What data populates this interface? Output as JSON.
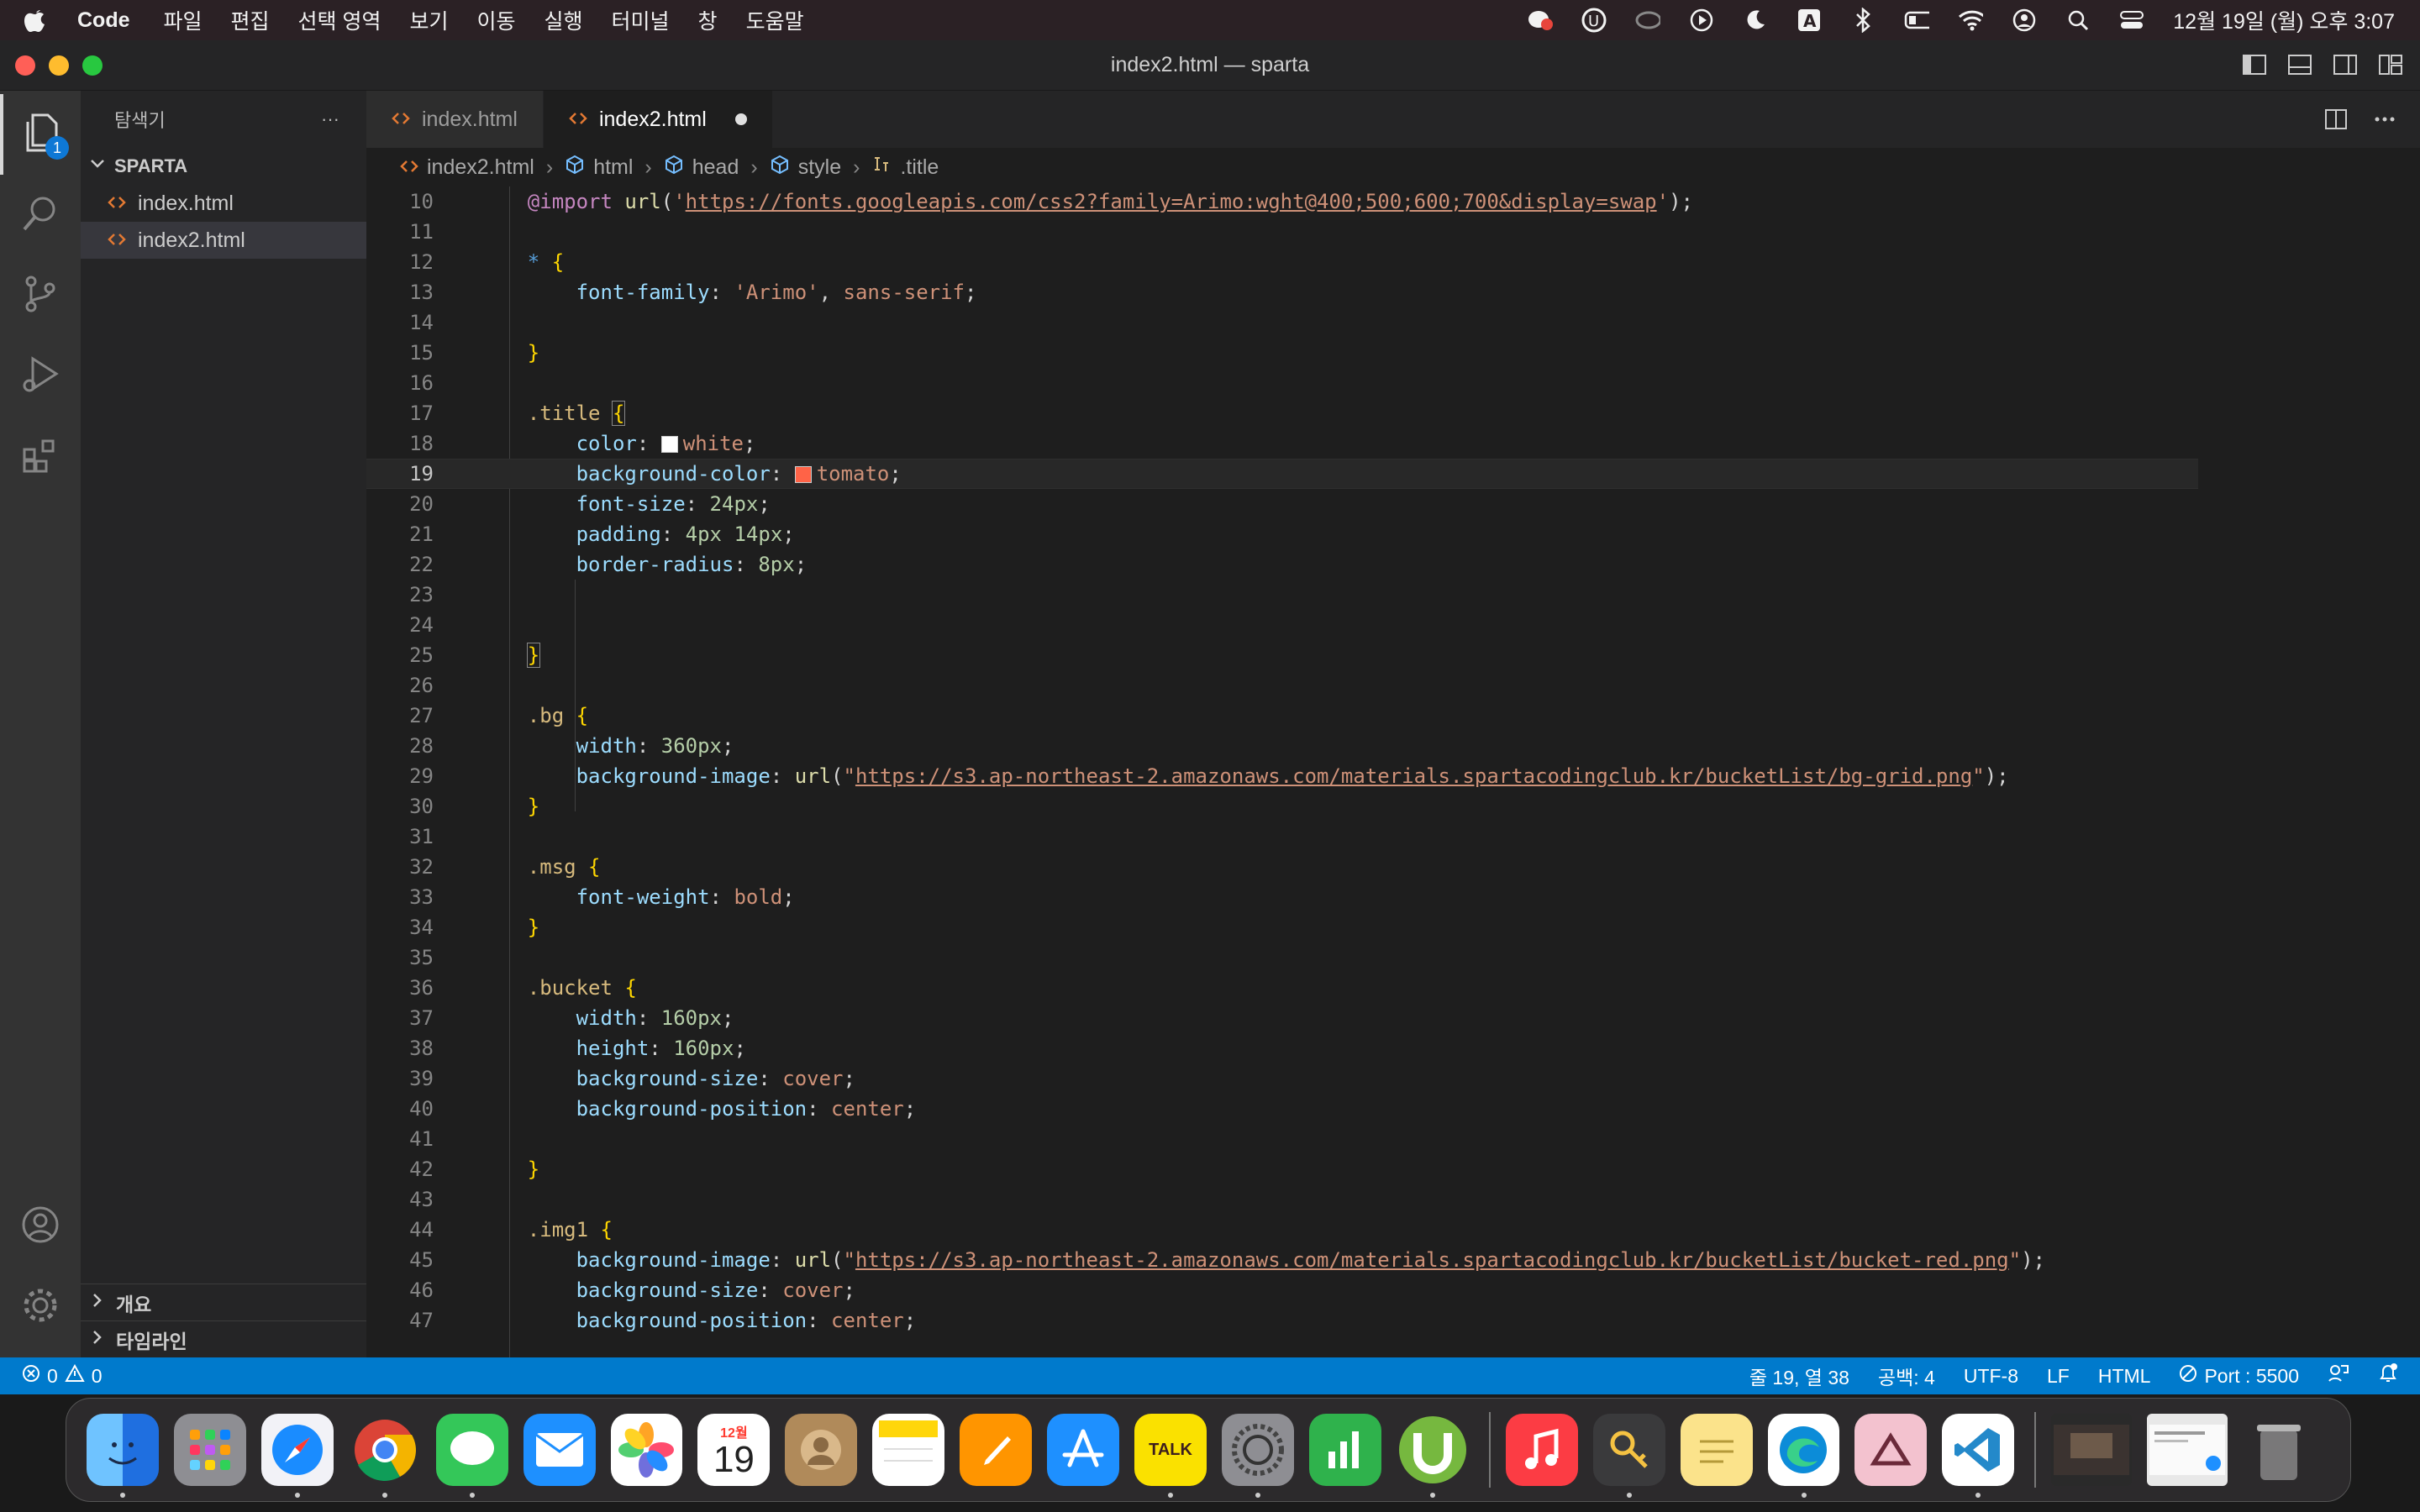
{
  "menubar": {
    "app": "Code",
    "items": [
      "파일",
      "편집",
      "선택 영역",
      "보기",
      "이동",
      "실행",
      "터미널",
      "창",
      "도움말"
    ],
    "clock": "12월 19일 (월) 오후 3:07"
  },
  "window": {
    "title": "index2.html — sparta"
  },
  "activitybar": {
    "explorer_badge": "1"
  },
  "sidebar": {
    "title": "탐색기",
    "more": "···",
    "folder": "SPARTA",
    "files": [
      "index.html",
      "index2.html"
    ],
    "outline": "개요",
    "timeline": "타임라인"
  },
  "tabs": [
    {
      "label": "index.html"
    },
    {
      "label": "index2.html"
    }
  ],
  "breadcrumb": {
    "file": "index2.html",
    "html": "html",
    "head": "head",
    "style": "style",
    "selector": ".title"
  },
  "editor": {
    "current_line": 19,
    "line_numbers": [
      "10",
      "11",
      "12",
      "13",
      "14",
      "15",
      "16",
      "17",
      "18",
      "19",
      "20",
      "21",
      "22",
      "23",
      "24",
      "25",
      "26",
      "27",
      "28",
      "29",
      "30",
      "31",
      "32",
      "33",
      "34",
      "35",
      "36",
      "37",
      "38",
      "39",
      "40",
      "41",
      "42",
      "43",
      "44",
      "45",
      "46",
      "47"
    ],
    "import_url": "https://fonts.googleapis.com/css2?family=Arimo:wght@400;500;600;700&display=swap",
    "bg_url": "https://s3.ap-northeast-2.amazonaws.com/materials.spartacodingclub.kr/bucketList/bg-grid.png",
    "img1_url": "https://s3.ap-northeast-2.amazonaws.com/materials.spartacodingclub.kr/bucketList/bucket-red.png",
    "white_swatch": "#ffffff",
    "tomato_swatch": "#ff6347"
  },
  "statusbar": {
    "errors": "0",
    "warnings": "0",
    "position": "줄 19, 열 38",
    "spaces": "공백: 4",
    "encoding": "UTF-8",
    "eol": "LF",
    "language": "HTML",
    "port": "Port : 5500"
  },
  "dock": {
    "calendar_month": "12월",
    "calendar_day": "19",
    "kakao_label": "TALK"
  }
}
